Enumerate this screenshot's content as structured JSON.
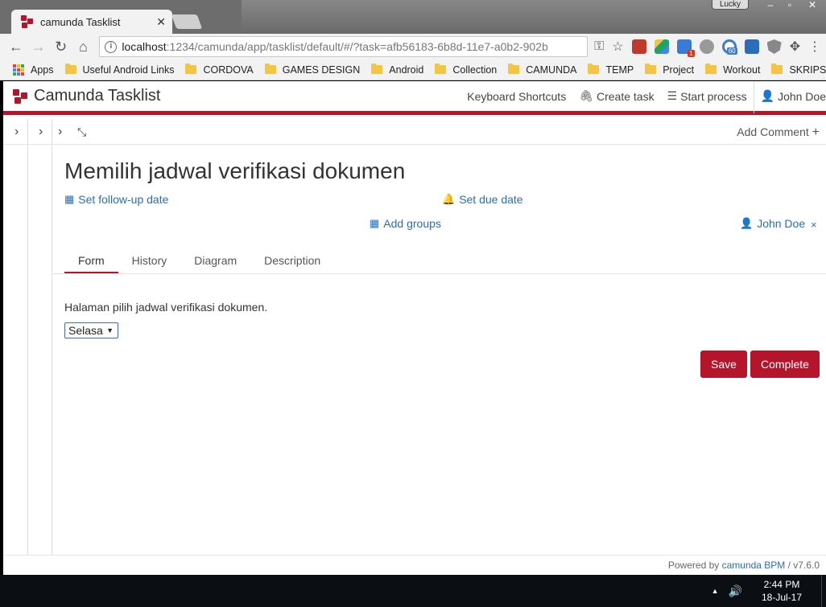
{
  "browser": {
    "tab_title": "camunda Tasklist",
    "user_chip": "Lucky",
    "url_host": "localhost",
    "url_path": ":1234/camunda/app/tasklist/default/#/?task=afb56183-6b8d-11e7-a0b2-902b",
    "ext_badge_red": "1",
    "ext_badge_blue": "60",
    "bookmarks": [
      {
        "label": "Apps"
      },
      {
        "label": "Useful Android Links"
      },
      {
        "label": "CORDOVA"
      },
      {
        "label": "GAMES DESIGN"
      },
      {
        "label": "Android"
      },
      {
        "label": "Collection"
      },
      {
        "label": "CAMUNDA"
      },
      {
        "label": "TEMP"
      },
      {
        "label": "Project"
      },
      {
        "label": "Workout"
      },
      {
        "label": "SKRIPSI"
      }
    ],
    "more": "»"
  },
  "app": {
    "brand": "Camunda Tasklist",
    "nav": {
      "shortcuts": "Keyboard Shortcuts",
      "create_task": "Create task",
      "start_process": "Start process",
      "user": "John Doe"
    },
    "add_comment": "Add Comment"
  },
  "task": {
    "title": "Memilih jadwal verifikasi dokumen",
    "follow_up": "Set follow-up date",
    "due_date": "Set due date",
    "add_groups": "Add groups",
    "assignee": "John Doe",
    "unassign": "×",
    "tabs": [
      {
        "label": "Form"
      },
      {
        "label": "History"
      },
      {
        "label": "Diagram"
      },
      {
        "label": "Description"
      }
    ],
    "form_text": "Halaman pilih jadwal verifikasi dokumen.",
    "select_value": "Selasa",
    "save": "Save",
    "complete": "Complete"
  },
  "footer": {
    "prefix": "Powered by",
    "link": "camunda BPM",
    "version": "/ v7.6.0"
  },
  "taskbar": {
    "time": "2:44 PM",
    "date": "18-Jul-17"
  }
}
